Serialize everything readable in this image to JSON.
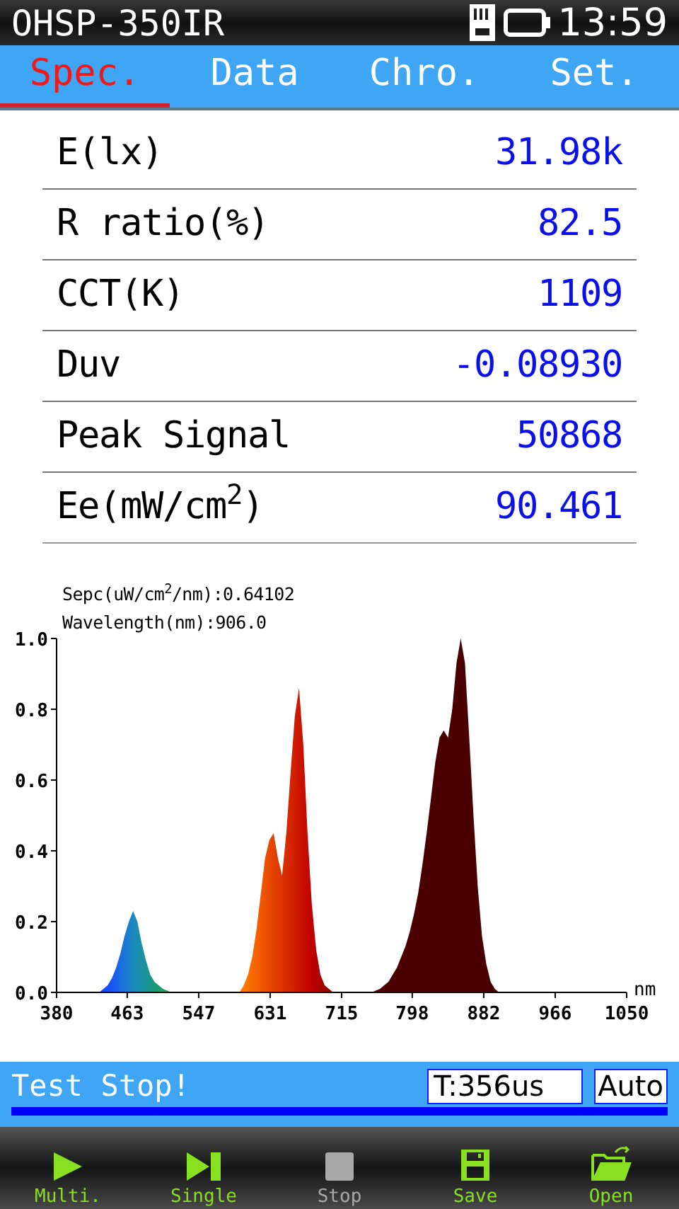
{
  "status_bar": {
    "device": "OHSP-350IR",
    "time": "13:59"
  },
  "tabs": [
    {
      "label": "Spec.",
      "selected": true
    },
    {
      "label": "Data",
      "selected": false
    },
    {
      "label": "Chro.",
      "selected": false
    },
    {
      "label": "Set.",
      "selected": false
    }
  ],
  "measurements": [
    {
      "label": "E(lx)",
      "value": "31.98k"
    },
    {
      "label": "R ratio(%)",
      "value": "82.5"
    },
    {
      "label": "CCT(K)",
      "value": "1109"
    },
    {
      "label": "Duv",
      "value": "-0.08930"
    },
    {
      "label": "Peak Signal",
      "value": "50868"
    },
    {
      "label": "Ee(mW/cm$^{2}$)",
      "value": "90.461"
    }
  ],
  "spectrum": {
    "readouts": [
      "Sepc(uW/cm$^{2}$/nm):0.64102",
      "Wavelength(nm):906.0"
    ],
    "chart_data": {
      "type": "area",
      "xlabel": "nm",
      "xlim": [
        380,
        1050
      ],
      "ylim": [
        0,
        1
      ],
      "xticks": [
        380,
        463,
        547,
        631,
        715,
        798,
        882,
        966,
        1050
      ],
      "yticks": [
        {
          "value": 0,
          "label": "0.0"
        },
        {
          "value": 0.2,
          "label": "0.2"
        },
        {
          "value": 0.4,
          "label": "0.4"
        },
        {
          "value": 0.6,
          "label": "0.6"
        },
        {
          "value": 0.8,
          "label": "0.8"
        },
        {
          "value": 1,
          "label": "1.0"
        }
      ],
      "x": [
        380,
        385,
        390,
        395,
        400,
        405,
        410,
        415,
        420,
        425,
        430,
        435,
        440,
        445,
        450,
        455,
        460,
        465,
        470,
        475,
        480,
        485,
        490,
        495,
        500,
        505,
        510,
        515,
        520,
        525,
        530,
        535,
        540,
        545,
        550,
        555,
        560,
        565,
        570,
        575,
        580,
        585,
        590,
        595,
        600,
        605,
        610,
        615,
        620,
        625,
        630,
        635,
        640,
        645,
        650,
        655,
        660,
        665,
        670,
        675,
        680,
        685,
        690,
        695,
        700,
        705,
        710,
        715,
        720,
        725,
        730,
        735,
        740,
        745,
        750,
        755,
        760,
        765,
        770,
        775,
        780,
        785,
        790,
        795,
        800,
        805,
        810,
        815,
        820,
        825,
        830,
        835,
        840,
        845,
        850,
        855,
        860,
        865,
        870,
        875,
        880,
        885,
        890,
        895,
        900,
        905,
        910,
        915,
        920,
        925,
        930,
        935,
        940,
        945,
        950,
        955,
        960,
        965,
        970,
        975,
        980,
        985,
        990,
        995,
        1000,
        1005,
        1010,
        1015,
        1020,
        1025,
        1030,
        1035,
        1040,
        1045,
        1050
      ],
      "series": [
        {
          "values": [
            0,
            0,
            0,
            0,
            0,
            0,
            0,
            0,
            0,
            0,
            0,
            0.01,
            0.02,
            0.04,
            0.07,
            0.11,
            0.16,
            0.2,
            0.23,
            0.2,
            0.14,
            0.09,
            0.05,
            0.03,
            0.02,
            0.01,
            0.005,
            0,
            0,
            0,
            0,
            0,
            0,
            0,
            0,
            0,
            0,
            0,
            0,
            0,
            0,
            0,
            0,
            0,
            0.02,
            0.05,
            0.1,
            0.18,
            0.28,
            0.38,
            0.43,
            0.45,
            0.38,
            0.33,
            0.45,
            0.62,
            0.78,
            0.86,
            0.7,
            0.45,
            0.25,
            0.12,
            0.05,
            0.02,
            0.01,
            0,
            0,
            0,
            0,
            0,
            0,
            0,
            0,
            0,
            0,
            0.005,
            0.01,
            0.02,
            0.03,
            0.05,
            0.07,
            0.1,
            0.13,
            0.17,
            0.22,
            0.28,
            0.36,
            0.45,
            0.55,
            0.65,
            0.72,
            0.74,
            0.72,
            0.8,
            0.93,
            1,
            0.93,
            0.72,
            0.5,
            0.3,
            0.16,
            0.08,
            0.03,
            0.01,
            0,
            0,
            0,
            0,
            0,
            0,
            0,
            0,
            0,
            0,
            0,
            0,
            0,
            0,
            0,
            0,
            0,
            0,
            0,
            0,
            0,
            0,
            0,
            0,
            0,
            0,
            0,
            0,
            0,
            0,
            0
          ]
        }
      ]
    }
  },
  "test_bar": {
    "message": "Test Stop!",
    "exposure": "T:356us",
    "mode": "Auto"
  },
  "toolbar": [
    {
      "kind": "play",
      "label": "Multi.",
      "disabled": false
    },
    {
      "kind": "step",
      "label": "Single",
      "disabled": false
    },
    {
      "kind": "stop",
      "label": "Stop",
      "disabled": true
    },
    {
      "kind": "save",
      "label": "Save",
      "disabled": false
    },
    {
      "kind": "open",
      "label": "Open",
      "disabled": false
    }
  ]
}
